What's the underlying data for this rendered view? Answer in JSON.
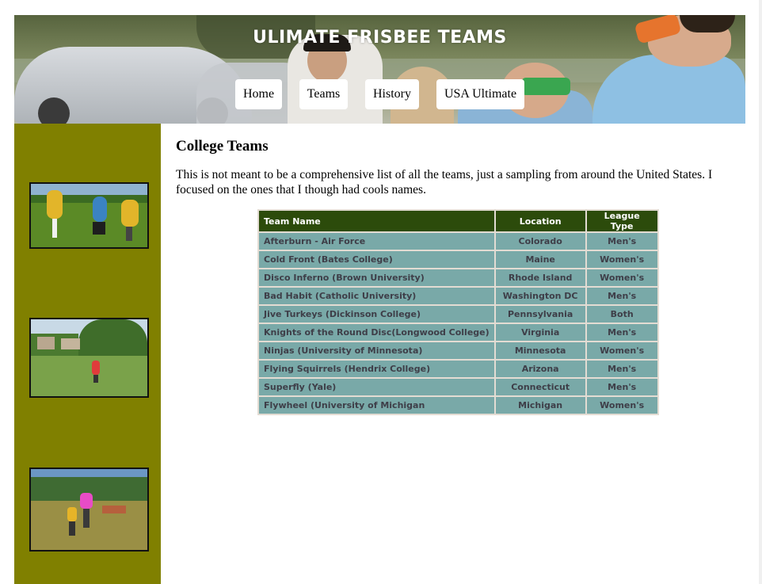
{
  "header": {
    "title": "ULIMATE FRISBEE TEAMS",
    "nav": [
      "Home",
      "Teams",
      "History",
      "USA Ultimate"
    ]
  },
  "sidebar": {
    "photos": [
      "frisbee-action-photo",
      "frisbee-field-photo",
      "frisbee-catch-photo"
    ]
  },
  "main": {
    "heading": "College Teams",
    "intro": "This is not meant to be a comprehensive list of all the teams, just a sampling from around the United States. I focused on the ones that I though had cools names.",
    "table": {
      "headers": [
        "Team Name",
        "Location",
        "League Type"
      ],
      "rows": [
        [
          "Afterburn - Air Force",
          "Colorado",
          "Men's"
        ],
        [
          "Cold Front (Bates College)",
          "Maine",
          "Women's"
        ],
        [
          "Disco Inferno (Brown University)",
          "Rhode Island",
          "Women's"
        ],
        [
          "Bad Habit (Catholic University)",
          "Washington DC",
          "Men's"
        ],
        [
          "Jive Turkeys (Dickinson College)",
          "Pennsylvania",
          "Both"
        ],
        [
          "Knights of the Round Disc(Longwood College)",
          "Virginia",
          "Men's"
        ],
        [
          "Ninjas (University of Minnesota)",
          "Minnesota",
          "Women's"
        ],
        [
          "Flying Squirrels (Hendrix College)",
          "Arizona",
          "Men's"
        ],
        [
          "Superfly (Yale)",
          "Connecticut",
          "Men's"
        ],
        [
          "Flywheel (University of Michigan",
          "Michigan",
          "Women's"
        ]
      ]
    }
  },
  "colors": {
    "sidebar": "#808000",
    "table_header": "#2c4b0b",
    "table_cell": "#79a9a8",
    "table_border": "#e3dcd3"
  }
}
